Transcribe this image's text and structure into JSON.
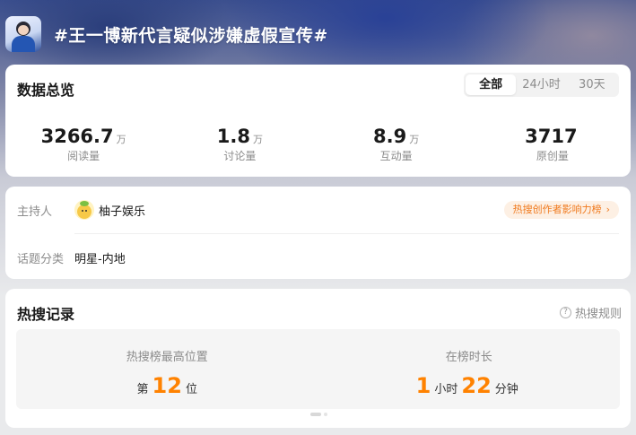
{
  "header": {
    "title": "#王一博新代言疑似涉嫌虚假宣传#"
  },
  "overview": {
    "title": "数据总览",
    "tabs": [
      {
        "label": "全部",
        "active": true
      },
      {
        "label": "24小时",
        "active": false
      },
      {
        "label": "30天",
        "active": false
      }
    ],
    "stats": [
      {
        "value": "3266.7",
        "unit": "万",
        "label": "阅读量"
      },
      {
        "value": "1.8",
        "unit": "万",
        "label": "讨论量"
      },
      {
        "value": "8.9",
        "unit": "万",
        "label": "互动量"
      },
      {
        "value": "3717",
        "unit": "",
        "label": "原创量"
      }
    ]
  },
  "info": {
    "host_label": "主持人",
    "host_name": "柚子娱乐",
    "badge_label": "热搜创作者影响力榜",
    "category_label": "话题分类",
    "category_value": "明星-内地"
  },
  "hot": {
    "title": "热搜记录",
    "rules_label": "热搜规则",
    "rank_label": "热搜榜最高位置",
    "rank_prefix": "第",
    "rank_value": "12",
    "rank_suffix": "位",
    "duration_label": "在榜时长",
    "hours": "1",
    "hours_unit": "小时",
    "minutes": "22",
    "minutes_unit": "分钟"
  },
  "colors": {
    "accent_orange": "#ff8200",
    "badge_text": "#f07a1e",
    "badge_bg": "#fdf0e4"
  }
}
